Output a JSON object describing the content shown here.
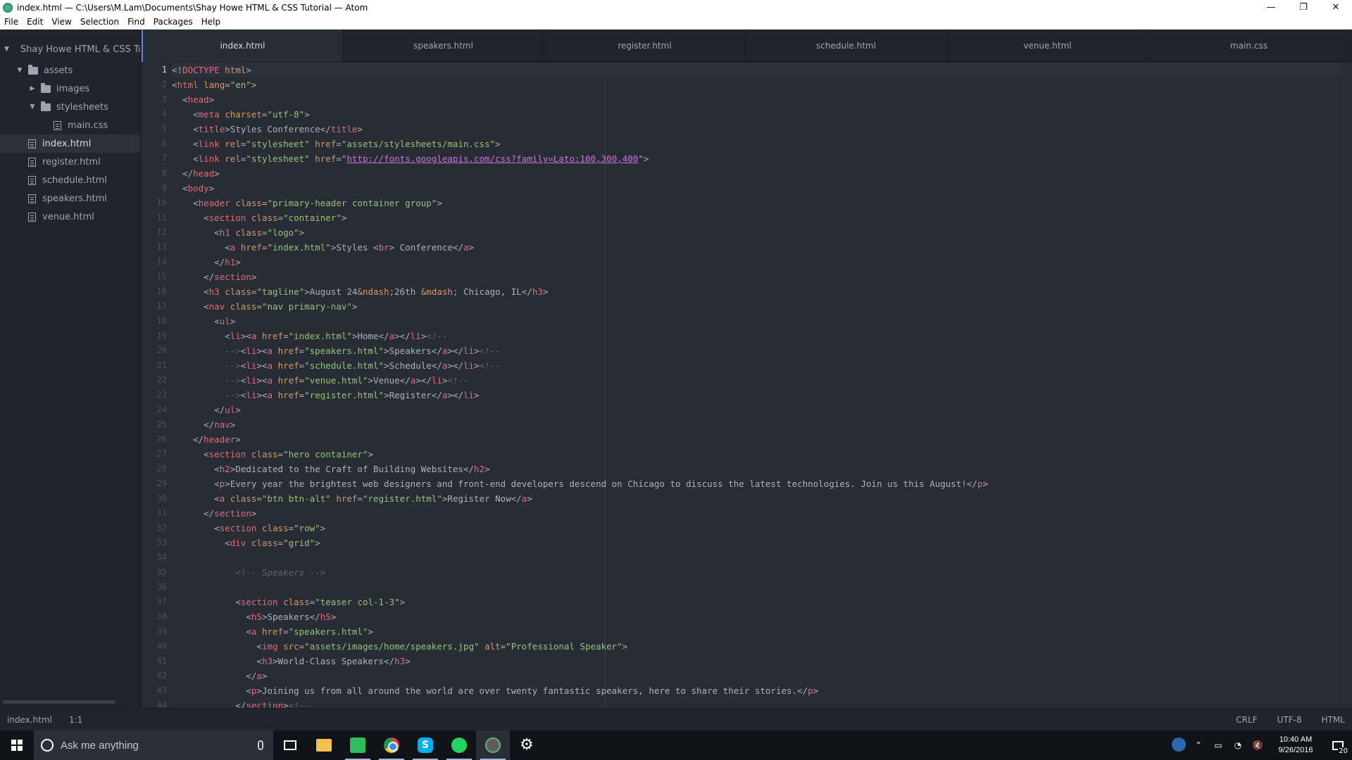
{
  "window": {
    "title": "index.html — C:\\Users\\M.Lam\\Documents\\Shay Howe HTML & CSS Tutorial — Atom",
    "minimize_glyph": "—",
    "maximize_glyph": "❐",
    "close_glyph": "✕"
  },
  "menu": [
    "File",
    "Edit",
    "View",
    "Selection",
    "Find",
    "Packages",
    "Help"
  ],
  "sidebar": {
    "project": "Shay Howe HTML & CSS Tu",
    "items": [
      {
        "label": "assets",
        "type": "folder",
        "expanded": true
      },
      {
        "label": "images",
        "type": "folder",
        "expanded": false
      },
      {
        "label": "stylesheets",
        "type": "folder",
        "expanded": true
      },
      {
        "label": "main.css",
        "type": "file"
      },
      {
        "label": "index.html",
        "type": "file",
        "selected": true
      },
      {
        "label": "register.html",
        "type": "file"
      },
      {
        "label": "schedule.html",
        "type": "file"
      },
      {
        "label": "speakers.html",
        "type": "file"
      },
      {
        "label": "venue.html",
        "type": "file"
      }
    ]
  },
  "tabs": [
    {
      "label": "index.html",
      "active": true
    },
    {
      "label": "speakers.html"
    },
    {
      "label": "register.html"
    },
    {
      "label": "schedule.html"
    },
    {
      "label": "venue.html"
    },
    {
      "label": "main.css"
    }
  ],
  "editor": {
    "cursor_line": 1,
    "lines": [
      "<!DOCTYPE html>",
      "<html lang=\"en\">",
      "  <head>",
      "    <meta charset=\"utf-8\">",
      "    <title>Styles Conference</title>",
      "    <link rel=\"stylesheet\" href=\"assets/stylesheets/main.css\">",
      "    <link rel=\"stylesheet\" href=\"http://fonts.googleapis.com/css?family=Lato:100,300,400\">",
      "  </head>",
      "  <body>",
      "    <header class=\"primary-header container group\">",
      "      <section class=\"container\">",
      "        <h1 class=\"logo\">",
      "          <a href=\"index.html\">Styles <br> Conference</a>",
      "        </h1>",
      "      </section>",
      "      <h3 class=\"tagline\">August 24&ndash;26th &mdash; Chicago, IL</h3>",
      "      <nav class=\"nav primary-nav\">",
      "        <ul>",
      "          <li><a href=\"index.html\">Home</a></li><!--",
      "          --><li><a href=\"speakers.html\">Speakers</a></li><!--",
      "          --><li><a href=\"schedule.html\">Schedule</a></li><!--",
      "          --><li><a href=\"venue.html\">Venue</a></li><!--",
      "          --><li><a href=\"register.html\">Register</a></li>",
      "        </ul>",
      "      </nav>",
      "    </header>",
      "      <section class=\"hero container\">",
      "        <h2>Dedicated to the Craft of Building Websites</h2>",
      "        <p>Every year the brightest web designers and front-end developers descend on Chicago to discuss the latest technologies. Join us this August!</p>",
      "        <a class=\"btn btn-alt\" href=\"register.html\">Register Now</a>",
      "      </section>",
      "        <section class=\"row\">",
      "          <div class=\"grid\">",
      "",
      "            <!-- Speakers -->",
      "",
      "            <section class=\"teaser col-1-3\">",
      "              <h5>Speakers</h5>",
      "              <a href=\"speakers.html\">",
      "                <img src=\"assets/images/home/speakers.jpg\" alt=\"Professional Speaker\">",
      "                <h3>World-Class Speakers</h3>",
      "              </a>",
      "              <p>Joining us from all around the world are over twenty fantastic speakers, here to share their stories.</p>",
      "            </section><!--"
    ]
  },
  "status": {
    "file": "index.html",
    "position": "1:1",
    "line_ending": "CRLF",
    "encoding": "UTF-8",
    "grammar": "HTML"
  },
  "taskbar": {
    "search_placeholder": "Ask me anything",
    "time": "10:40 AM",
    "date": "9/26/2016",
    "notifications": "20",
    "apps": [
      "task-view",
      "file-explorer",
      "evernote",
      "chrome",
      "skype",
      "spotify",
      "atom",
      "settings"
    ]
  },
  "colors": {
    "accent": "#568af2",
    "editor_bg": "#282c34",
    "sidebar_bg": "#21252b",
    "tag": "#e06c75",
    "attribute": "#d19a66",
    "string": "#98c379",
    "comment": "#5c6370"
  }
}
